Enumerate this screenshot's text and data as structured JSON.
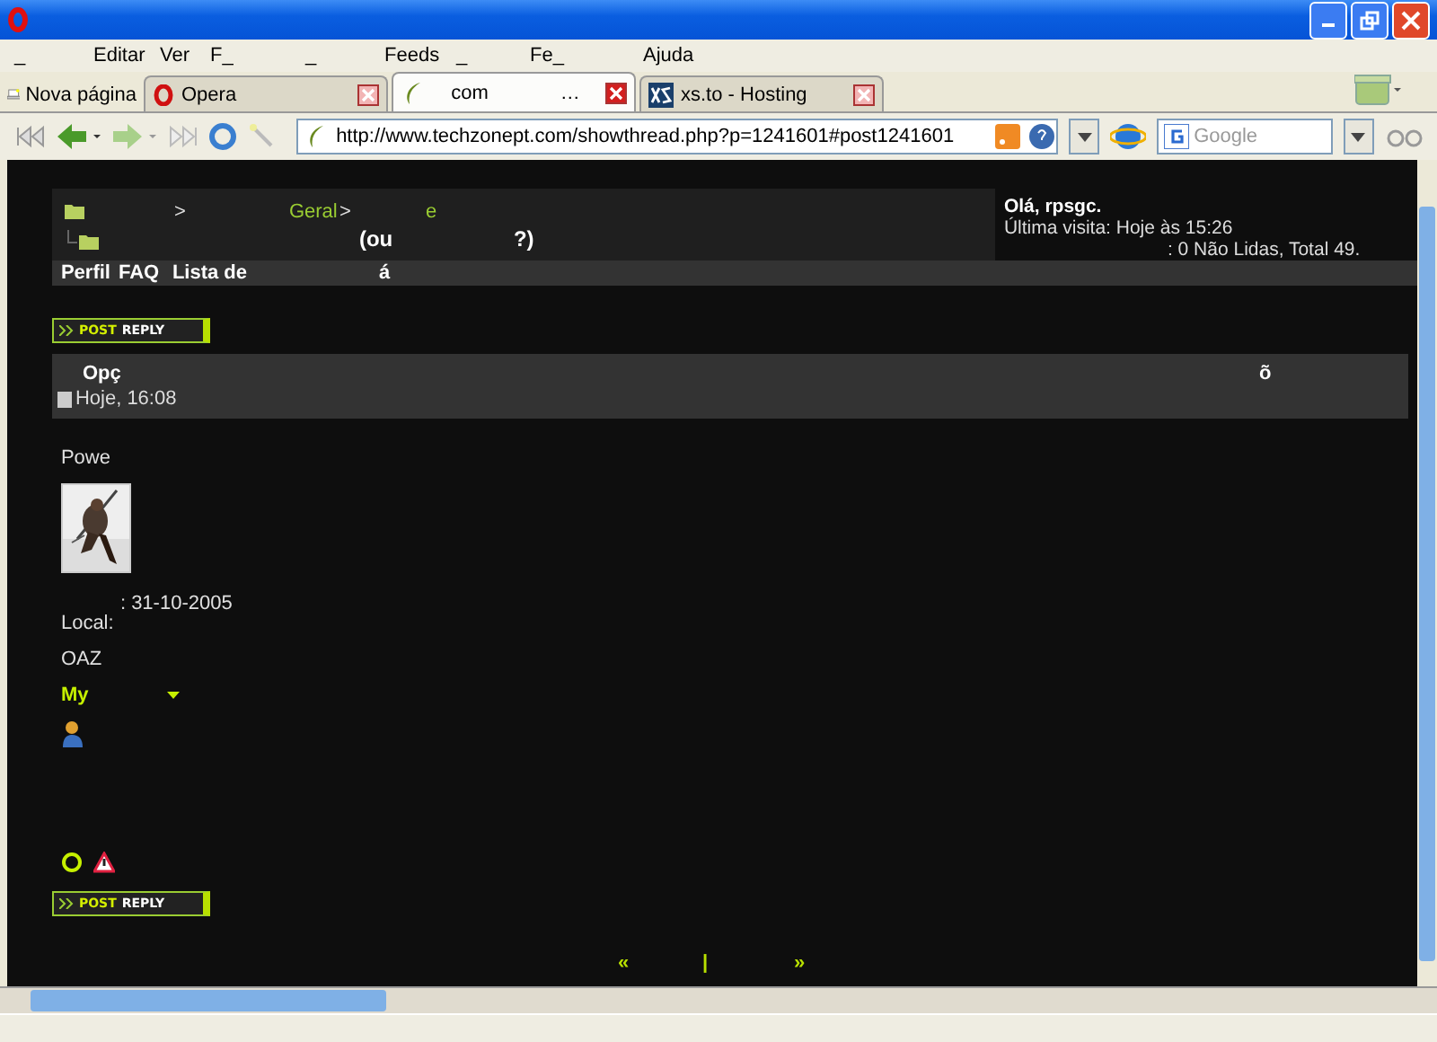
{
  "menu": [
    "_",
    "Editar",
    "Ver",
    "F_",
    "_",
    "Feeds",
    "_",
    "Fe_",
    "Ajuda"
  ],
  "tabs": {
    "new_page": "Nova página",
    "items": [
      {
        "label": "Opera",
        "kind": "opera",
        "selected": false
      },
      {
        "label": "com",
        "suffix": "…",
        "kind": "site",
        "selected": true
      },
      {
        "label": "xs.to - Hosting",
        "kind": "xs",
        "selected": false
      }
    ]
  },
  "address_bar": {
    "url": "http://www.techzonept.com/showthread.php?p=1241601#post1241601"
  },
  "search": {
    "placeholder": "Google"
  },
  "breadcrumb": {
    "line1": [
      ">",
      "Geral",
      ">",
      "e"
    ],
    "line2": [
      "(ou",
      "?)"
    ]
  },
  "user_box": {
    "greeting": "Olá, rpsgc.",
    "visit_label": "Última visita: Hoje às",
    "visit_time": "15:26",
    "messages": ": 0 Não Lidas, Total 49."
  },
  "navbar": [
    "Perfil",
    "FAQ",
    "Lista de",
    "á"
  ],
  "reply_button": [
    "POST",
    "REPLY"
  ],
  "reply_button_bottom": [
    "POST",
    "REPLY"
  ],
  "post": {
    "header_left": "Opç",
    "header_right": "õ",
    "date": "Hoje, 16:08",
    "user_title": "Powe",
    "joined": ": 31-10-2005",
    "location": "Local:",
    "extra": "OAZ",
    "menu_label": "My"
  },
  "pagination": [
    "«",
    "|",
    "»"
  ]
}
